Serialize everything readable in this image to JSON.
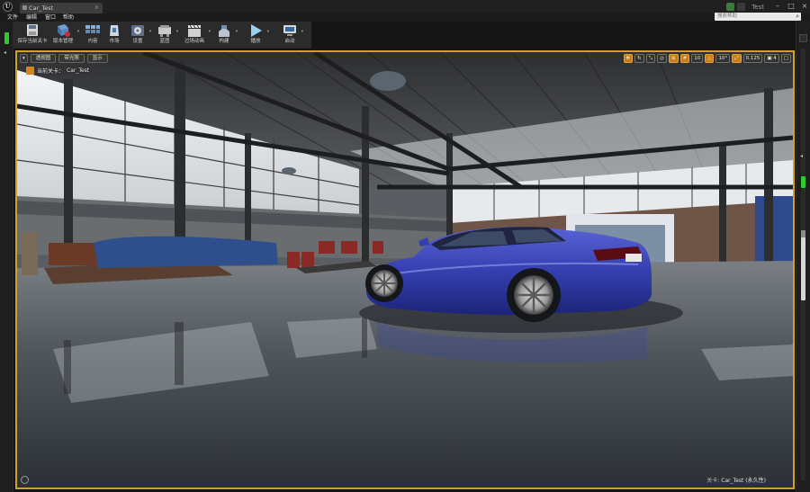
{
  "window": {
    "tab_title": "Car_Test",
    "tab_close": "×",
    "logo_text": "U",
    "project_name": "Test",
    "minimize": "–",
    "maximize": "□",
    "close": "×"
  },
  "menu": {
    "items": [
      "文件",
      "编辑",
      "窗口",
      "帮助"
    ]
  },
  "search": {
    "placeholder": "搜索帮助",
    "icon": "search-icon"
  },
  "toolbar": {
    "buttons": [
      {
        "label": "保存当前关卡",
        "icon": "save-icon",
        "dropdown": false
      },
      {
        "label": "版本管理",
        "icon": "source-control-icon",
        "dropdown": true
      },
      {
        "label": "内容",
        "icon": "content-icon",
        "dropdown": false
      },
      {
        "label": "市场",
        "icon": "marketplace-icon",
        "dropdown": false
      },
      {
        "label": "设置",
        "icon": "settings-icon",
        "dropdown": true
      },
      {
        "label": "蓝图",
        "icon": "blueprint-icon",
        "dropdown": true
      },
      {
        "label": "过场动画",
        "icon": "cinematics-icon",
        "dropdown": true
      },
      {
        "label": "构建",
        "icon": "build-icon",
        "dropdown": true
      },
      {
        "label": "播放",
        "icon": "play-icon",
        "dropdown": true
      },
      {
        "label": "启动",
        "icon": "launch-icon",
        "dropdown": true
      }
    ]
  },
  "viewport": {
    "buttons": [
      "透视图",
      "带光照",
      "显示"
    ],
    "menu_glyph": "▾",
    "level_label": "当前关卡：",
    "level_name": "Car_Test",
    "right_controls": {
      "grid_snap_value": "10",
      "rotation_snap_value": "10°",
      "scale_snap_value": "0.125",
      "camera_speed": "4"
    },
    "footer_prefix": "关卡:",
    "footer_level": "Car_Test (永久性)"
  },
  "colors": {
    "accent_orange": "#d0a02a",
    "status_green": "#30c930",
    "car_blue": "#3540b0"
  }
}
